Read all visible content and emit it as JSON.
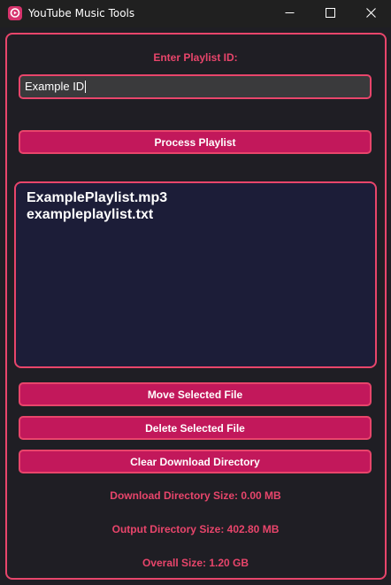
{
  "window": {
    "title": "YouTube Music Tools",
    "controls": {
      "minimize_icon": "minimize-icon",
      "maximize_icon": "maximize-icon",
      "close_icon": "close-icon"
    }
  },
  "form": {
    "playlist_label": "Enter Playlist ID:",
    "playlist_input_value": "Example ID",
    "process_button": "Process Playlist"
  },
  "files": {
    "items": [
      "ExamplePlaylist.mp3",
      "exampleplaylist.txt"
    ]
  },
  "actions": {
    "move_button": "Move Selected File",
    "delete_button": "Delete Selected File",
    "clear_button": "Clear Download Directory"
  },
  "stats": {
    "download_size": "Download Directory Size: 0.00 MB",
    "output_size": "Output Directory Size: 402.80 MB",
    "overall_size": "Overall Size: 1.20 GB"
  },
  "colors": {
    "accent": "#e8456b",
    "button_fill": "#c2185b",
    "background": "#1f1e24",
    "list_background": "#1c1d38",
    "input_background": "#3a3a3c"
  }
}
